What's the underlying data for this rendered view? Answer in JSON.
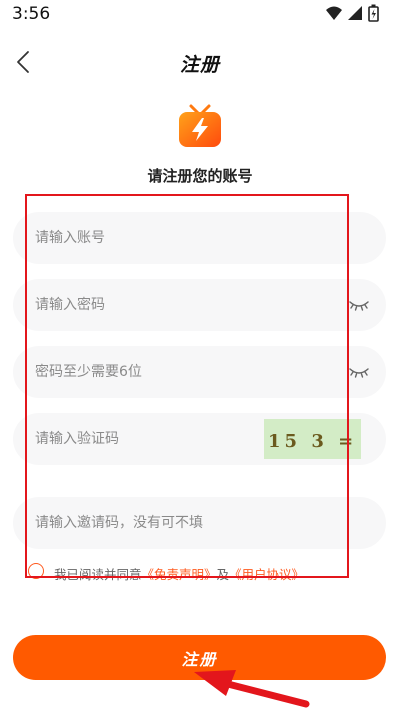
{
  "status_bar": {
    "time": "3:56",
    "icons": [
      "wifi-icon",
      "signal-icon",
      "battery-icon"
    ]
  },
  "header": {
    "title": "注册",
    "back_icon": "chevron-left-icon"
  },
  "logo": {
    "icon": "tv-lightning-logo-icon"
  },
  "subtitle": "请注册您的账号",
  "form": {
    "account_placeholder": "请输入账号",
    "password_placeholder": "请输入密码",
    "password_hint_placeholder": "密码至少需要6位",
    "captcha_placeholder": "请输入验证码",
    "captcha_text": "15 3 = ?",
    "invite_placeholder": "请输入邀请码，没有可不填"
  },
  "agreement": {
    "prefix": "我已阅读并同意",
    "disclaimer_link": "《免责声明》",
    "and": "及",
    "user_agreement_link": "《用户协议》"
  },
  "submit_label": "注册",
  "colors": {
    "accent": "#ff5a00",
    "annotation": "#e3161c",
    "field_bg": "#f7f7f8",
    "captcha_bg": "#d3ecc6"
  }
}
